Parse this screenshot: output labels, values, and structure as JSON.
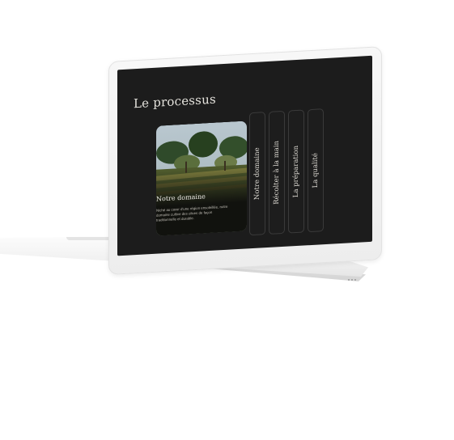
{
  "page": {
    "title": "Le processus"
  },
  "featured_card": {
    "title": "Notre domaine",
    "text": "Niché au cœur d'une région ensoleillée, notre domaine cultive des olives de façon traditionnelle et durable.",
    "image": "olive-grove-photo"
  },
  "tabs": [
    {
      "label": "Notre domaine"
    },
    {
      "label": "Récolter à la main"
    },
    {
      "label": "La préparation"
    },
    {
      "label": "La qualité"
    }
  ],
  "colors": {
    "screen_background": "#1c1c1c",
    "text_light": "#e4e2dc",
    "laptop_body": "#f2f2f2"
  }
}
